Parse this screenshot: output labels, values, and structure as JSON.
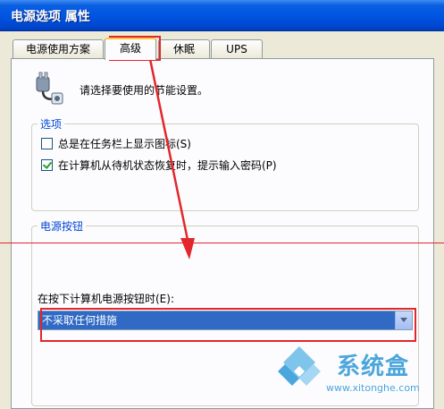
{
  "window": {
    "title": "电源选项 属性"
  },
  "tabs": [
    {
      "label": "电源使用方案"
    },
    {
      "label": "高级"
    },
    {
      "label": "休眠"
    },
    {
      "label": "UPS"
    }
  ],
  "header": {
    "description": "请选择要使用的节能设置。"
  },
  "options": {
    "title": "选项",
    "items": [
      {
        "label": "总是在任务栏上显示图标(S)",
        "checked": false
      },
      {
        "label": "在计算机从待机状态恢复时，提示输入密码(P)",
        "checked": true
      }
    ]
  },
  "power_buttons": {
    "title": "电源按钮",
    "action_label": "在按下计算机电源按钮时(E):",
    "action_value": "不采取任何措施"
  },
  "watermark": {
    "brand": "系统盒",
    "url": "www.xitonghe.com"
  },
  "colors": {
    "titlebar": "#0056e2",
    "annotation": "#e3262b",
    "group_title": "#0046d5",
    "selection": "#316ac5"
  },
  "icons": [
    "power-plug-icon",
    "dropdown-arrow-icon",
    "annotation-arrow-icon",
    "watermark-logo-icon"
  ]
}
